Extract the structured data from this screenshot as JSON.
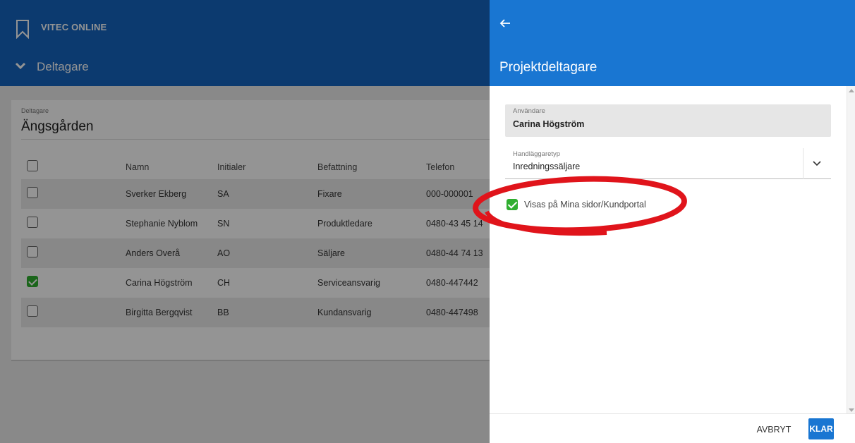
{
  "app": {
    "brand": "VITEC ONLINE",
    "section_title": "Deltagare"
  },
  "card": {
    "label": "Deltagare",
    "title": "Ängsgården"
  },
  "table": {
    "columns": [
      "Namn",
      "Initialer",
      "Befattning",
      "Telefon"
    ],
    "rows": [
      {
        "name": "Sverker Ekberg",
        "initials": "SA",
        "title": "Fixare",
        "phone": "000-000001",
        "checked": false
      },
      {
        "name": "Stephanie Nyblom",
        "initials": "SN",
        "title": "Produktledare",
        "phone": "0480-43 45 14",
        "checked": false
      },
      {
        "name": "Anders Overå",
        "initials": "AO",
        "title": "Säljare",
        "phone": "0480-44 74 13",
        "checked": false
      },
      {
        "name": "Carina Högström",
        "initials": "CH",
        "title": "Serviceansvarig",
        "phone": "0480-447442",
        "checked": true
      },
      {
        "name": "Birgitta Bergqvist",
        "initials": "BB",
        "title": "Kundansvarig",
        "phone": "0480-447498",
        "checked": false
      }
    ]
  },
  "panel": {
    "title": "Projektdeltagare",
    "user_field": {
      "label": "Användare",
      "value": "Carina Högström"
    },
    "type_field": {
      "label": "Handläggaretyp",
      "value": "Inredningssäljare"
    },
    "visible_checkbox": {
      "label": "Visas på Mina sidor/Kundportal",
      "checked": true
    },
    "cancel_label": "AVBRYT",
    "ok_label": "KLAR"
  },
  "colors": {
    "app_header": "#1565c0",
    "panel_header": "#1976d2",
    "checkbox_checked": "#2fae2f",
    "annotation_ring": "#e0141b"
  },
  "icons": {
    "logo": "bookmark-icon",
    "section": "chevron-down-icon",
    "back": "arrow-left-icon",
    "dropdown": "chevron-down-icon"
  }
}
